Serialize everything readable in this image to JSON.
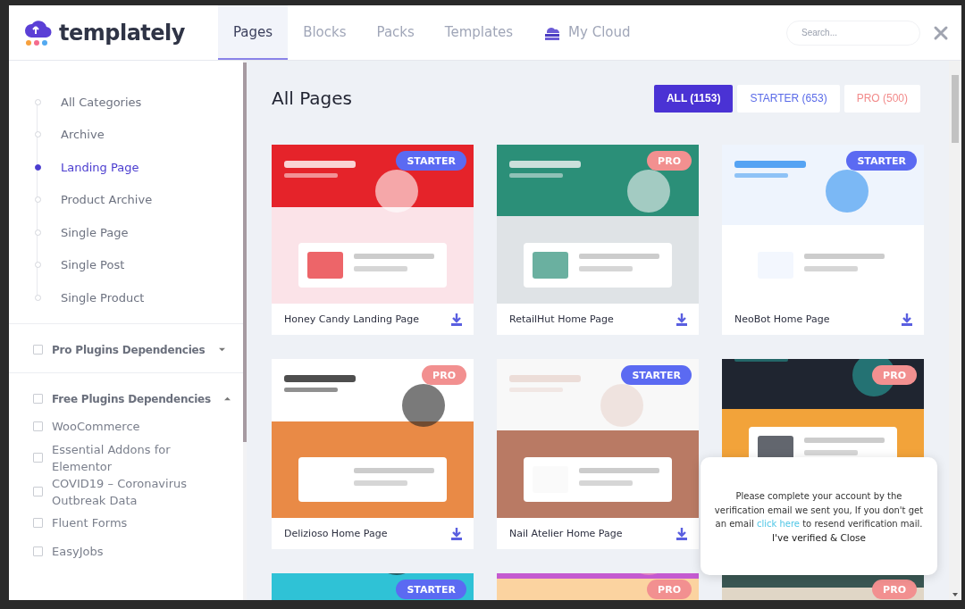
{
  "header": {
    "logo_text": "templately",
    "tabs": [
      {
        "label": "Pages",
        "selected": true
      },
      {
        "label": "Blocks",
        "selected": false
      },
      {
        "label": "Packs",
        "selected": false
      },
      {
        "label": "Templates",
        "selected": false
      },
      {
        "label": "My Cloud",
        "selected": false,
        "kind": "cloud"
      }
    ],
    "search": {
      "placeholder": "Search..."
    }
  },
  "sidebar": {
    "categories": [
      {
        "label": "All Categories",
        "selected": false
      },
      {
        "label": "Archive",
        "selected": false
      },
      {
        "label": "Landing Page",
        "selected": true
      },
      {
        "label": "Product Archive",
        "selected": false
      },
      {
        "label": "Single Page",
        "selected": false
      },
      {
        "label": "Single Post",
        "selected": false
      },
      {
        "label": "Single Product",
        "selected": false
      }
    ],
    "dependency_groups": [
      {
        "label": "Pro Plugins Dependencies",
        "checked": false,
        "expanded": false
      },
      {
        "label": "Free Plugins Dependencies",
        "checked": false,
        "expanded": true,
        "children": [
          {
            "label": "WooCommerce",
            "checked": false
          },
          {
            "label": "Essential Addons for Elementor",
            "checked": false
          },
          {
            "label": "COVID19 – Coronavirus Outbreak Data",
            "checked": false
          },
          {
            "label": "Fluent Forms",
            "checked": false
          },
          {
            "label": "EasyJobs",
            "checked": false
          }
        ]
      }
    ]
  },
  "main": {
    "title": "All Pages",
    "filters": [
      {
        "label": "ALL (1153)",
        "kind": "all",
        "selected": true
      },
      {
        "label": "STARTER (653)",
        "kind": "starter",
        "selected": false
      },
      {
        "label": "PRO (500)",
        "kind": "pro",
        "selected": false
      }
    ],
    "cards": [
      {
        "title": "Honey Candy Landing Page",
        "badge": {
          "kind": "starter",
          "label": "STARTER"
        }
      },
      {
        "title": "RetailHut Home Page",
        "badge": {
          "kind": "pro",
          "label": "PRO"
        }
      },
      {
        "title": "NeoBot Home Page",
        "badge": {
          "kind": "starter",
          "label": "STARTER"
        }
      },
      {
        "title": "Delizioso Home Page",
        "badge": {
          "kind": "pro",
          "label": "PRO"
        }
      },
      {
        "title": "Nail Atelier Home Page",
        "badge": {
          "kind": "starter",
          "label": "STARTER"
        }
      },
      {
        "badge": {
          "kind": "pro",
          "label": "PRO"
        }
      },
      {
        "badge": {
          "kind": "starter",
          "label": "STARTER"
        }
      },
      {
        "badge": {
          "kind": "pro",
          "label": "PRO"
        }
      },
      {
        "badge": {
          "kind": "pro",
          "label": "PRO"
        }
      }
    ]
  },
  "notice": {
    "link": "click here",
    "before": "Please complete your account by the verification email we sent you, If you don't get an email",
    "after": "to resend verification mail.",
    "close_label": "I've verified & Close"
  }
}
